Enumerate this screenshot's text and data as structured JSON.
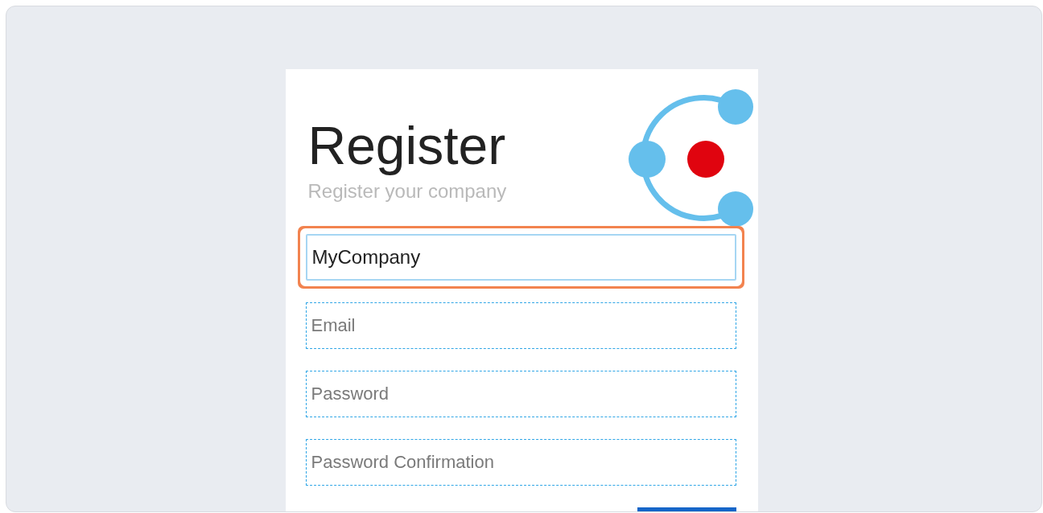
{
  "form": {
    "title": "Register",
    "subtitle": "Register your company",
    "fields": [
      {
        "value": "MyCompany",
        "focused": true
      },
      {
        "placeholder": "Email",
        "focused": false
      },
      {
        "placeholder": "Password",
        "focused": false
      },
      {
        "placeholder": "Password Confirmation",
        "focused": false
      }
    ]
  }
}
